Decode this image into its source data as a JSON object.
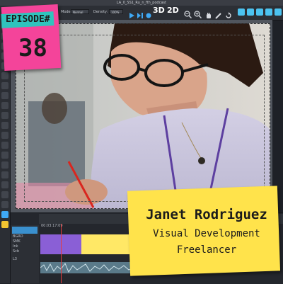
{
  "window": {
    "title": "LA_0_SS1_Ru_n_fth_podcast"
  },
  "toolbar": {
    "mode_label": "Mode:",
    "mode_value": "Normal",
    "density_label": "Density:",
    "density_value": "100%",
    "mode_3d": "3D",
    "mode_2d": "2D"
  },
  "episode": {
    "label": "EPISODE#",
    "number": "38"
  },
  "guest": {
    "name": "Janet Rodriguez",
    "role": "Visual Development",
    "company": "Freelancer"
  },
  "timeline": {
    "timecode": "00:03:17:09",
    "tracks": [
      "BGRD",
      "SMK",
      "Ink",
      "Scb"
    ],
    "audio_track": "L3"
  },
  "colors": {
    "episode_note": "#f4449a",
    "name_note": "#ffe34b",
    "toolbar_accent": "#3fa9f5",
    "clip_purple": "#8a5fd6",
    "clip_yellow": "#ffe866"
  }
}
